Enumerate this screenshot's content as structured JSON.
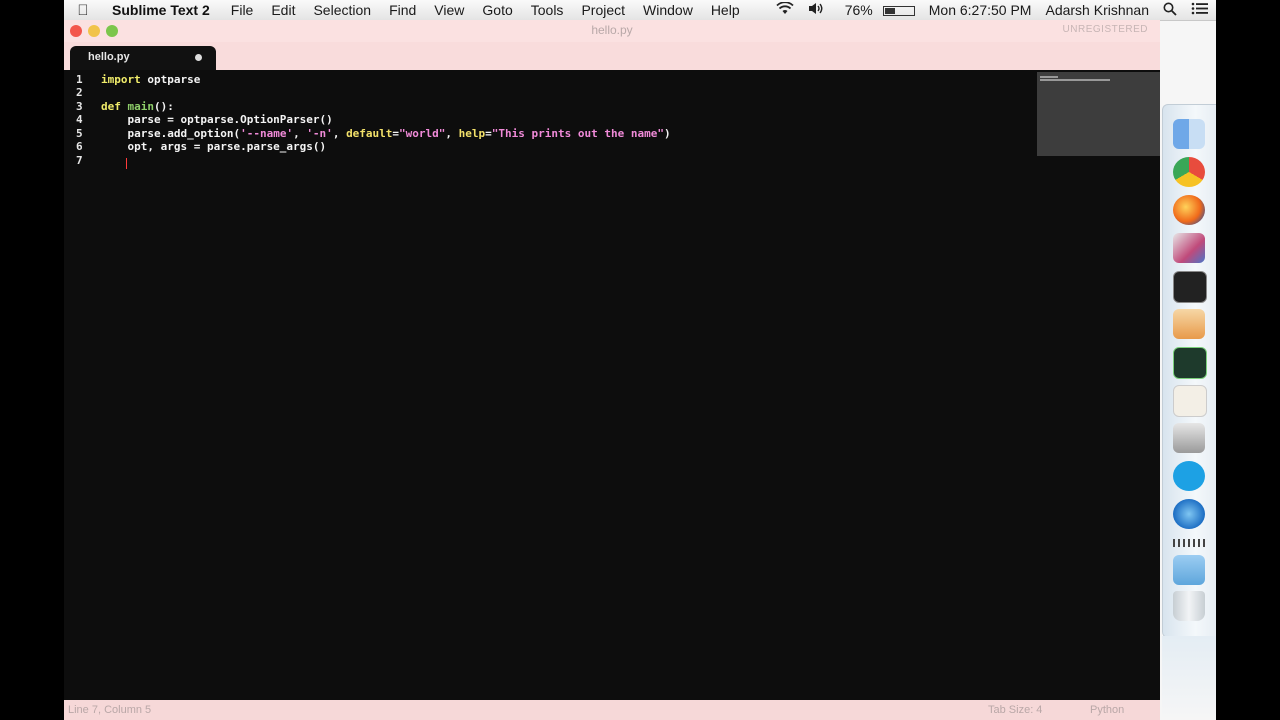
{
  "menubar": {
    "app_name": "Sublime Text 2",
    "menus": [
      "File",
      "Edit",
      "Selection",
      "Find",
      "View",
      "Goto",
      "Tools",
      "Project",
      "Window",
      "Help"
    ],
    "battery": "76%",
    "clock": "Mon 6:27:50 PM",
    "user": "Adarsh Krishnan"
  },
  "window": {
    "title": "hello.py",
    "unregistered": "UNREGISTERED"
  },
  "tab": {
    "label": "hello.py"
  },
  "editor": {
    "line_numbers": [
      "1",
      "2",
      "3",
      "4",
      "5",
      "6",
      "7"
    ],
    "lines": {
      "l1": {
        "kw": "import",
        "rest": " optparse"
      },
      "l3": {
        "kw": "def",
        "fn": "main",
        "rest": "():"
      },
      "l4": {
        "text": "    parse = optparse.OptionParser()"
      },
      "l5": {
        "pre": "    parse.add_option(",
        "s1": "'--name'",
        "c1": ", ",
        "s2": "'-n'",
        "c2": ", ",
        "a1": "default",
        "eq1": "=",
        "s3": "\"world\"",
        "c3": ", ",
        "a2": "help",
        "eq2": "=",
        "s4": "\"This prints out the name\"",
        "post": ")"
      },
      "l6": {
        "text": "    opt, args = parse.parse_args()"
      }
    }
  },
  "statusbar": {
    "left": "Line 7, Column 5",
    "tab_size": "Tab Size: 4",
    "syntax": "Python"
  },
  "colors": {
    "editor_bg": "#0d0d0d",
    "keyword": "#f0ec6a",
    "function": "#8fcf6a",
    "string": "#f08ad8",
    "chrome_tint": "#fbe1e1"
  },
  "dock": {
    "icons": [
      "finder-icon",
      "chrome-icon",
      "firefox-icon",
      "preview-icon",
      "terminal-icon",
      "sublime-icon",
      "activity-monitor-icon",
      "textedit-icon",
      "photo-icon",
      "skype-icon",
      "safari-icon",
      "folder-icon",
      "trash-icon"
    ]
  }
}
